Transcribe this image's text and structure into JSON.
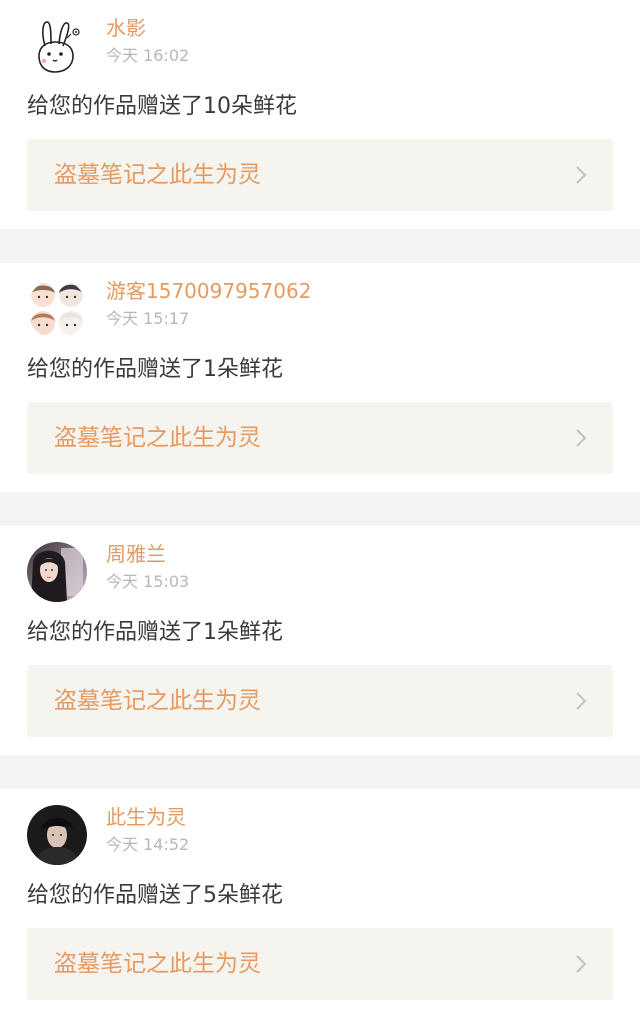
{
  "notifications": [
    {
      "user": "水影",
      "time": "今天 16:02",
      "message": "给您的作品赠送了10朵鲜花",
      "work_title": "盗墓笔记之此生为灵",
      "avatar_icon": "rabbit-sketch-avatar"
    },
    {
      "user": "游客1570097957062",
      "time": "今天 15:17",
      "message": "给您的作品赠送了1朵鲜花",
      "work_title": "盗墓笔记之此生为灵",
      "avatar_icon": "cartoon-group-avatar"
    },
    {
      "user": "周雅兰",
      "time": "今天 15:03",
      "message": "给您的作品赠送了1朵鲜花",
      "work_title": "盗墓笔记之此生为灵",
      "avatar_icon": "woman-photo-avatar"
    },
    {
      "user": "此生为灵",
      "time": "今天 14:52",
      "message": "给您的作品赠送了5朵鲜花",
      "work_title": "盗墓笔记之此生为灵",
      "avatar_icon": "man-photo-avatar"
    }
  ],
  "colors": {
    "accent": "#e59a62",
    "background": "#f5f4f2",
    "card": "#ffffff",
    "link_box": "#f6f4ee",
    "time_text": "#b7b7b7",
    "body_text": "#3a3a3a"
  }
}
